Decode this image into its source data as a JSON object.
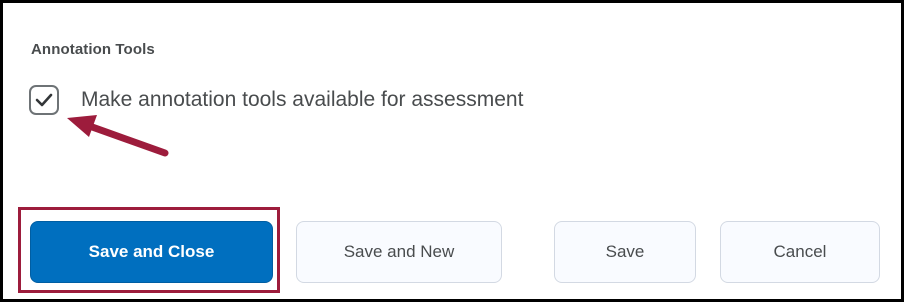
{
  "section": {
    "title": "Annotation Tools"
  },
  "annotation_checkbox": {
    "label": "Make annotation tools available for assessment",
    "checked": true,
    "icon": "checkmark-icon"
  },
  "callout": {
    "arrow_icon": "arrow-pointer-icon",
    "color": "#9d1c3c"
  },
  "buttons": {
    "save_and_close": "Save and Close",
    "save_and_new": "Save and New",
    "save": "Save",
    "cancel": "Cancel"
  },
  "colors": {
    "primary": "#006fbf",
    "highlight": "#9d1c3c",
    "text": "#494c4e"
  }
}
